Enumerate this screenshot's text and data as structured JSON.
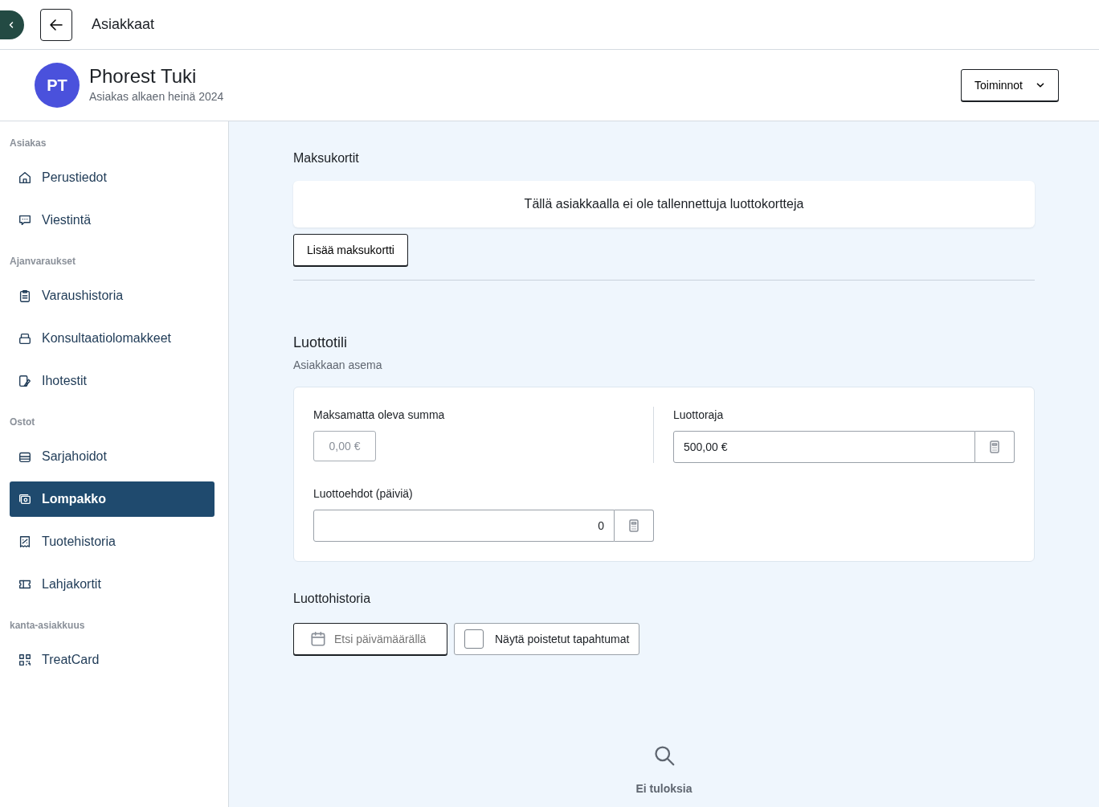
{
  "topbar": {
    "title": "Asiakkaat"
  },
  "client": {
    "initials": "PT",
    "name": "Phorest Tuki",
    "subtitle": "Asiakas alkaen heinä 2024",
    "actions": "Toiminnot"
  },
  "sidebar": {
    "groups": [
      {
        "heading": "Asiakas",
        "items": [
          {
            "label": "Perustiedot",
            "selected": false
          },
          {
            "label": "Viestintä",
            "selected": false
          }
        ]
      },
      {
        "heading": "Ajanvaraukset",
        "items": [
          {
            "label": "Varaushistoria",
            "selected": false
          },
          {
            "label": "Konsultaatiolomakkeet",
            "selected": false
          },
          {
            "label": "Ihotestit",
            "selected": false
          }
        ]
      },
      {
        "heading": "Ostot",
        "items": [
          {
            "label": "Sarjahoidot",
            "selected": false
          },
          {
            "label": "Lompakko",
            "selected": true
          },
          {
            "label": "Tuotehistoria",
            "selected": false
          },
          {
            "label": "Lahjakortit",
            "selected": false
          }
        ]
      },
      {
        "heading": "kanta-asiakkuus",
        "items": [
          {
            "label": "TreatCard",
            "selected": false
          }
        ]
      }
    ]
  },
  "cards": {
    "title": "Maksukortit",
    "empty": "Tällä asiakkaalla ei ole tallennettuja luottokortteja",
    "add": "Lisää maksukortti"
  },
  "credit": {
    "title": "Luottotili",
    "subtitle": "Asiakkaan asema",
    "outstanding": {
      "label": "Maksamatta oleva summa",
      "value": "0,00 €",
      "disabled": true
    },
    "limit": {
      "label": "Luottoraja",
      "value": "500,00 €"
    },
    "terms": {
      "label": "Luottoehdot (päiviä)",
      "value": "0"
    }
  },
  "history": {
    "title": "Luottohistoria",
    "date_filter": {
      "placeholder": "Etsi päivämäärällä"
    },
    "show_deleted": {
      "label": "Näytä poistetut tapahtumat",
      "checked": false
    },
    "empty": "Ei tuloksia"
  }
}
